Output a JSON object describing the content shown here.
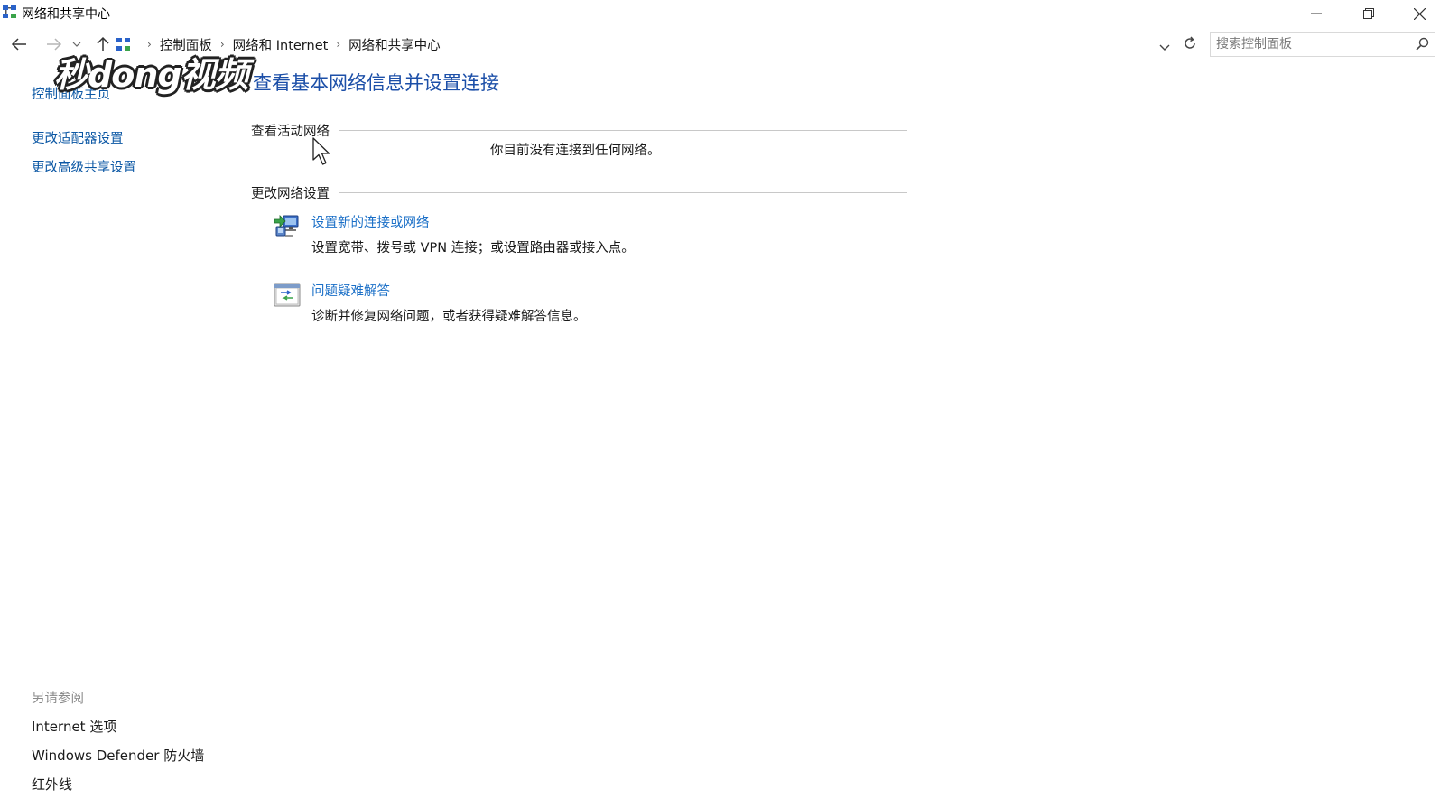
{
  "window": {
    "title": "网络和共享中心",
    "minimize_glyph": "—",
    "restore_glyph": "❐",
    "close_glyph": "✕"
  },
  "address_bar": {
    "breadcrumbs": [
      "控制面板",
      "网络和 Internet",
      "网络和共享中心"
    ],
    "search_placeholder": "搜索控制面板"
  },
  "sidebar": {
    "home_link": "控制面板主页",
    "links": [
      "更改适配器设置",
      "更改高级共享设置"
    ],
    "see_also_heading": "另请参阅",
    "see_also": [
      "Internet 选项",
      "Windows Defender 防火墙",
      "红外线"
    ]
  },
  "watermark": "秒dong视频",
  "main": {
    "title": "查看基本网络信息并设置连接",
    "active_networks": {
      "heading": "查看活动网络",
      "message": "你目前没有连接到任何网络。"
    },
    "change_settings": {
      "heading": "更改网络设置",
      "tasks": [
        {
          "icon": "network-setup-icon",
          "link": "设置新的连接或网络",
          "description": "设置宽带、拨号或 VPN 连接；或设置路由器或接入点。"
        },
        {
          "icon": "troubleshoot-icon",
          "link": "问题疑难解答",
          "description": "诊断并修复网络问题，或者获得疑难解答信息。"
        }
      ]
    }
  },
  "colors": {
    "link_blue": "#0b57a4",
    "title_blue": "#1c4fa8",
    "task_link_blue": "#1a6fc7",
    "muted_gray": "#8a8a8a"
  }
}
